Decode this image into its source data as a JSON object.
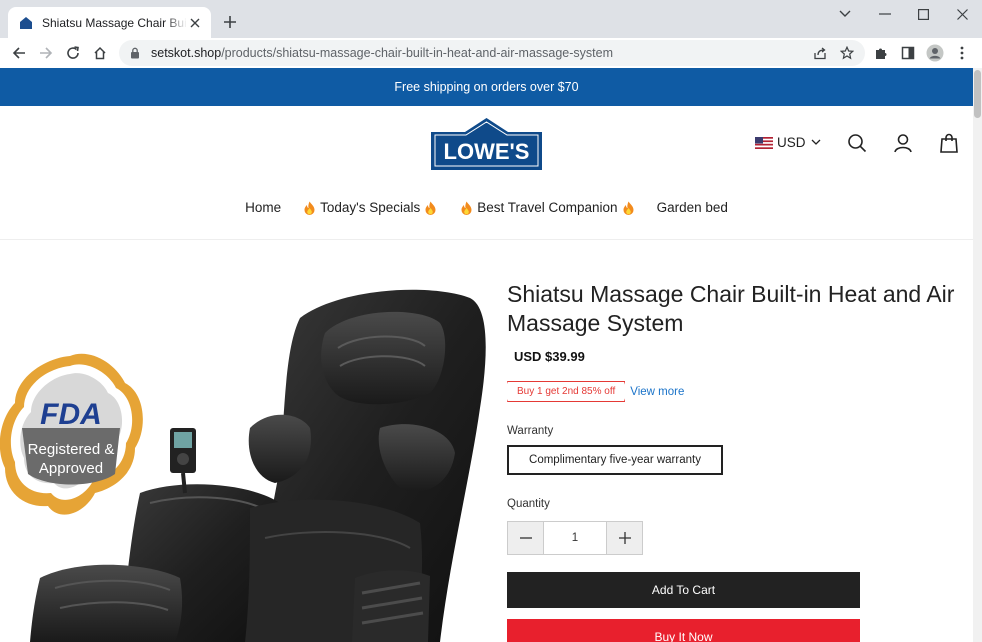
{
  "browser": {
    "tab_title": "Shiatsu Massage Chair Built-in Heat and Air Massage System",
    "url_host": "setskot.shop",
    "url_path": "/products/shiatsu-massage-chair-built-in-heat-and-air-massage-system"
  },
  "announcement": "Free shipping on orders over $70",
  "header": {
    "logo_text": "LOWE'S",
    "currency": "USD"
  },
  "nav": {
    "items": [
      "Home",
      "Today's Specials",
      "Best Travel Companion",
      "Garden bed"
    ]
  },
  "product": {
    "badge_top": "FDA",
    "badge_line1": "Registered &",
    "badge_line2": "Approved",
    "title": "Shiatsu Massage Chair Built-in Heat and Air Massage System",
    "price": "USD $39.99",
    "promo": "Buy 1 get 2nd 85% off",
    "view_more": "View more",
    "warranty_label": "Warranty",
    "warranty_option": "Complimentary five-year warranty",
    "quantity_label": "Quantity",
    "quantity": "1",
    "add_to_cart": "Add To Cart",
    "buy_now": "Buy It Now"
  },
  "colors": {
    "announcement_bg": "#0f5ba4",
    "buy_now_bg": "#e8202d",
    "add_to_cart_bg": "#222222",
    "promo": "#e53935",
    "link": "#1a73c9"
  }
}
